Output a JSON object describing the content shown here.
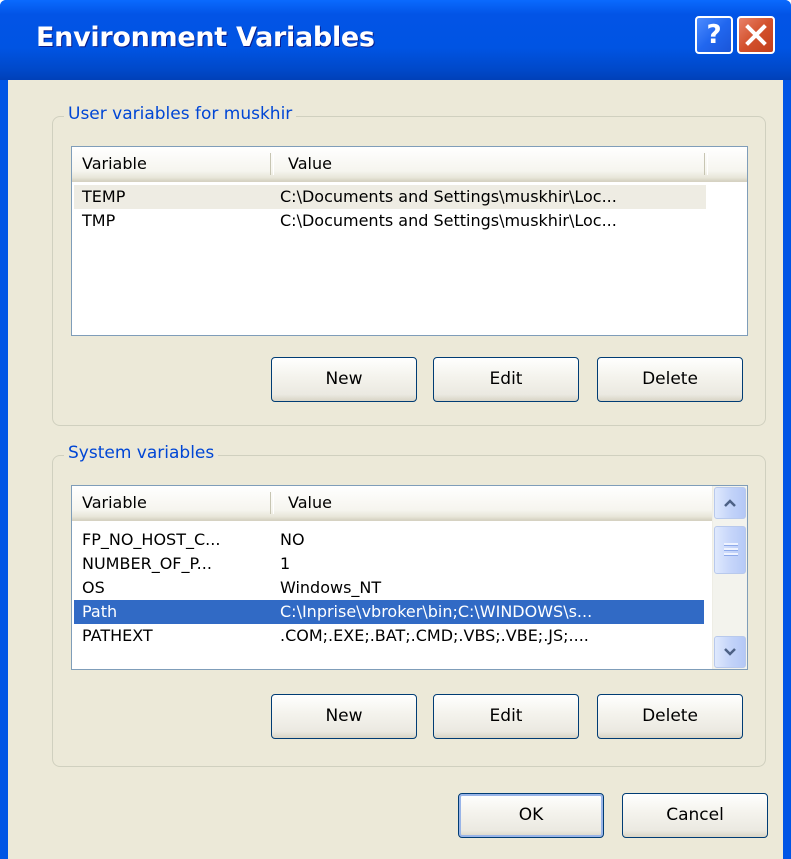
{
  "window": {
    "title": "Environment Variables",
    "help_symbol": "?"
  },
  "user_group": {
    "label": "User variables for muskhir",
    "columns": [
      "Variable",
      "Value"
    ],
    "rows": [
      {
        "variable": "TEMP",
        "value": "C:\\Documents and Settings\\muskhir\\Loc..."
      },
      {
        "variable": "TMP",
        "value": "C:\\Documents and Settings\\muskhir\\Loc..."
      }
    ],
    "buttons": {
      "new": "New",
      "edit": "Edit",
      "delete": "Delete"
    }
  },
  "system_group": {
    "label": "System variables",
    "columns": [
      "Variable",
      "Value"
    ],
    "rows": [
      {
        "variable": "FP_NO_HOST_C...",
        "value": "NO"
      },
      {
        "variable": "NUMBER_OF_P...",
        "value": "1"
      },
      {
        "variable": "OS",
        "value": "Windows_NT"
      },
      {
        "variable": "Path",
        "value": "C:\\Inprise\\vbroker\\bin;C:\\WINDOWS\\s..."
      },
      {
        "variable": "PATHEXT",
        "value": ".COM;.EXE;.BAT;.CMD;.VBS;.VBE;.JS;...."
      }
    ],
    "selected_row": "Path",
    "buttons": {
      "new": "New",
      "edit": "Edit",
      "delete": "Delete"
    }
  },
  "footer": {
    "ok": "OK",
    "cancel": "Cancel"
  },
  "colors": {
    "titlebar": "#0054e3",
    "dialog_bg": "#ece9d8",
    "group_label": "#0046d5",
    "selection": "#316ac5",
    "close_button": "#d3512c"
  },
  "icons": [
    "help-icon",
    "close-icon",
    "scroll-up-icon",
    "scroll-down-icon"
  ]
}
